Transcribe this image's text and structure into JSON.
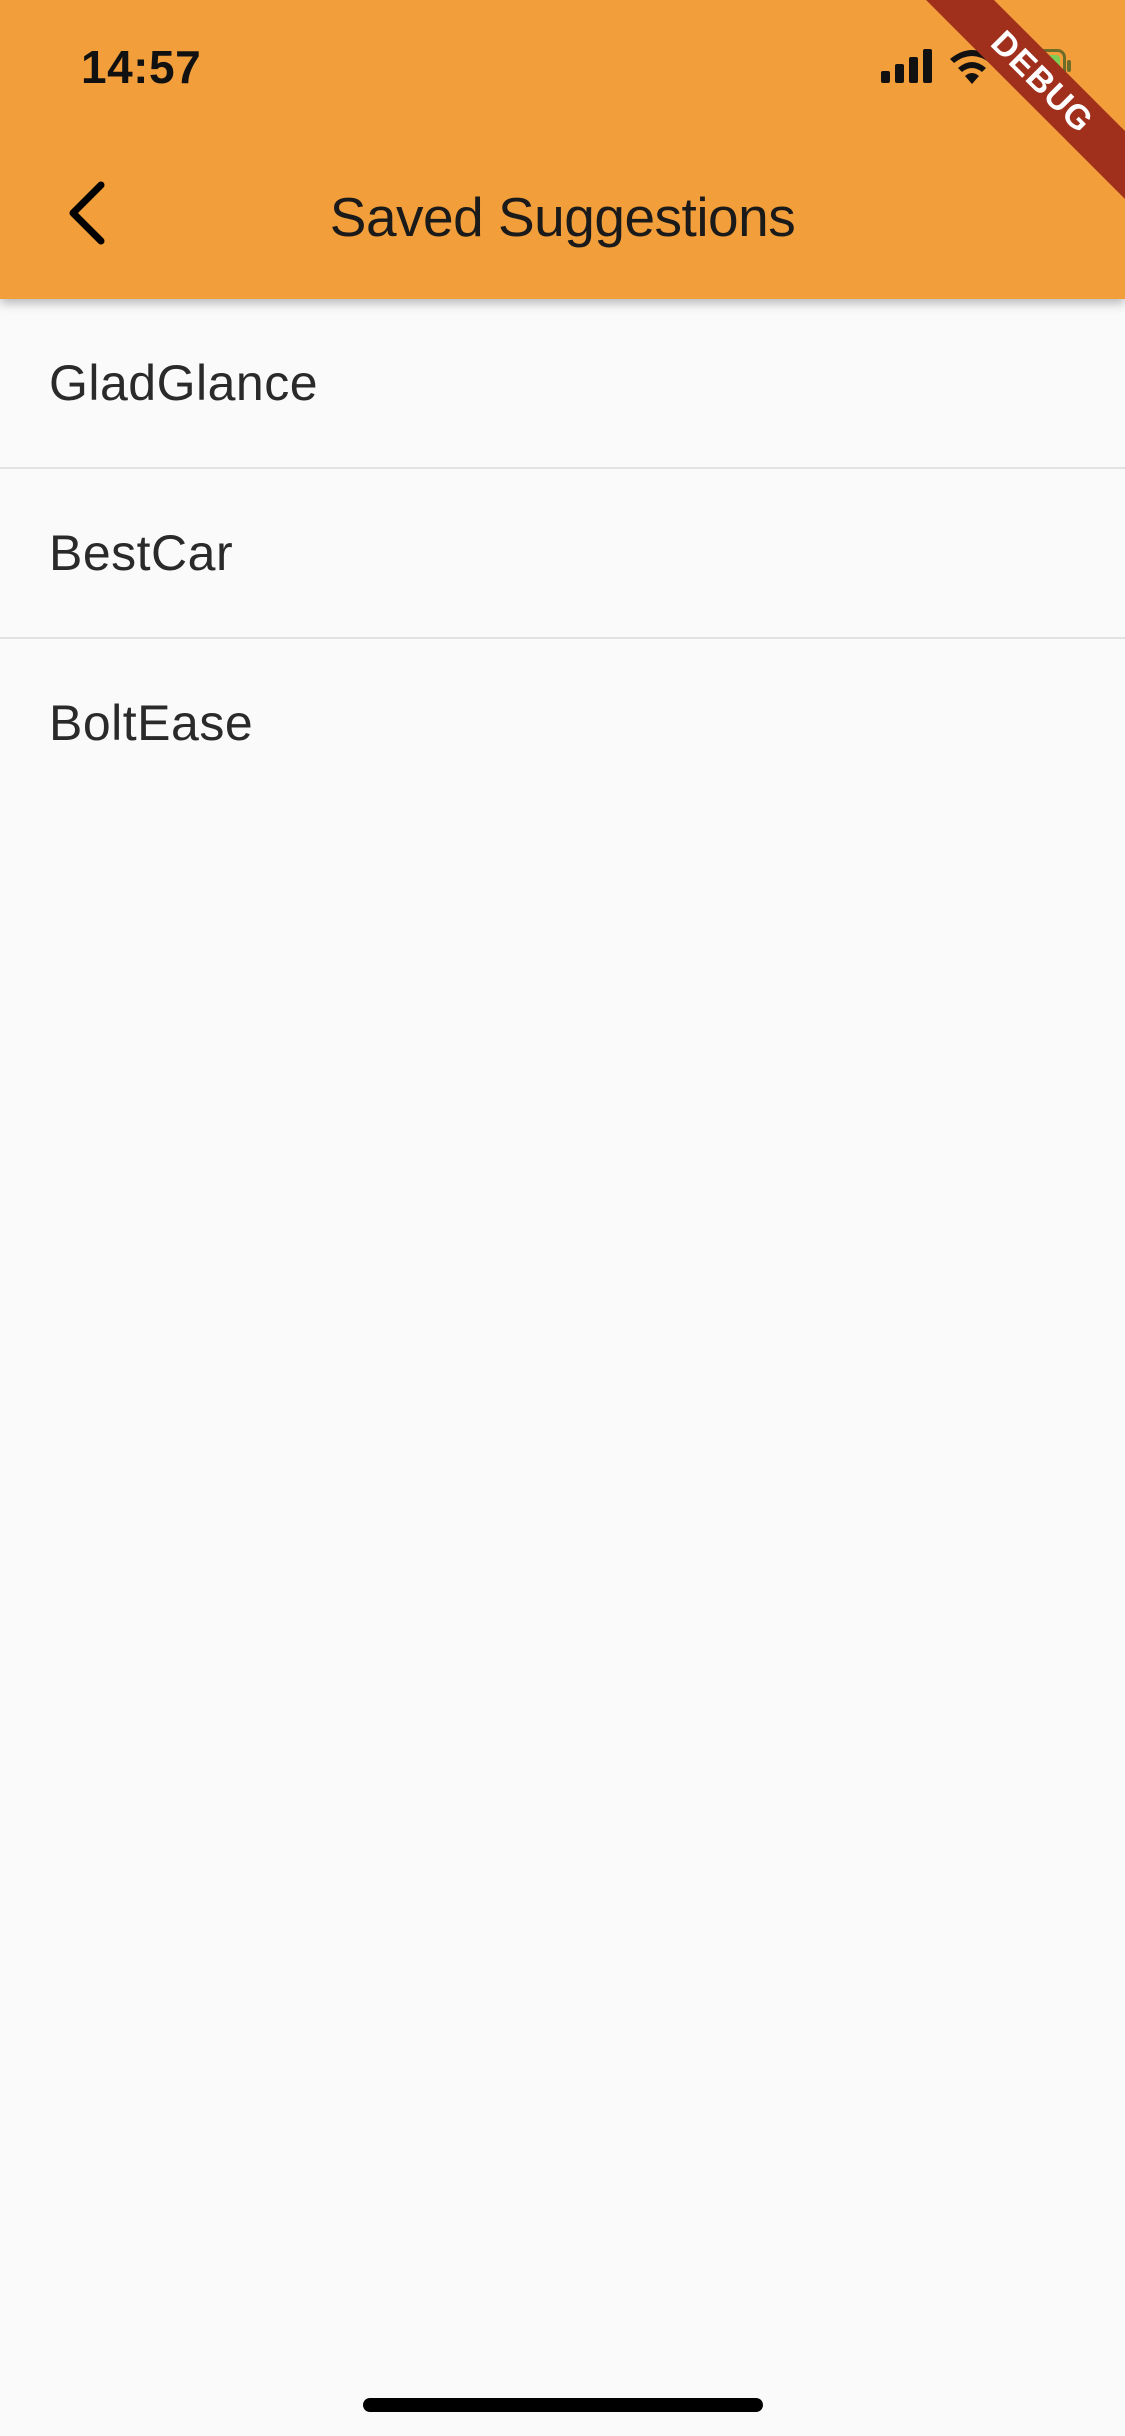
{
  "status_bar": {
    "time": "14:57",
    "icons": [
      "cellular-signal-icon",
      "wifi-icon",
      "battery-charging-icon"
    ]
  },
  "app_bar": {
    "title": "Saved Suggestions",
    "back_icon": "chevron-left-icon",
    "background_color": "#f29e3a"
  },
  "debug_banner": {
    "label": "DEBUG",
    "color": "#a0301c"
  },
  "saved_list": {
    "items": [
      {
        "label": "GladGlance"
      },
      {
        "label": "BestCar"
      },
      {
        "label": "BoltEase"
      }
    ]
  }
}
